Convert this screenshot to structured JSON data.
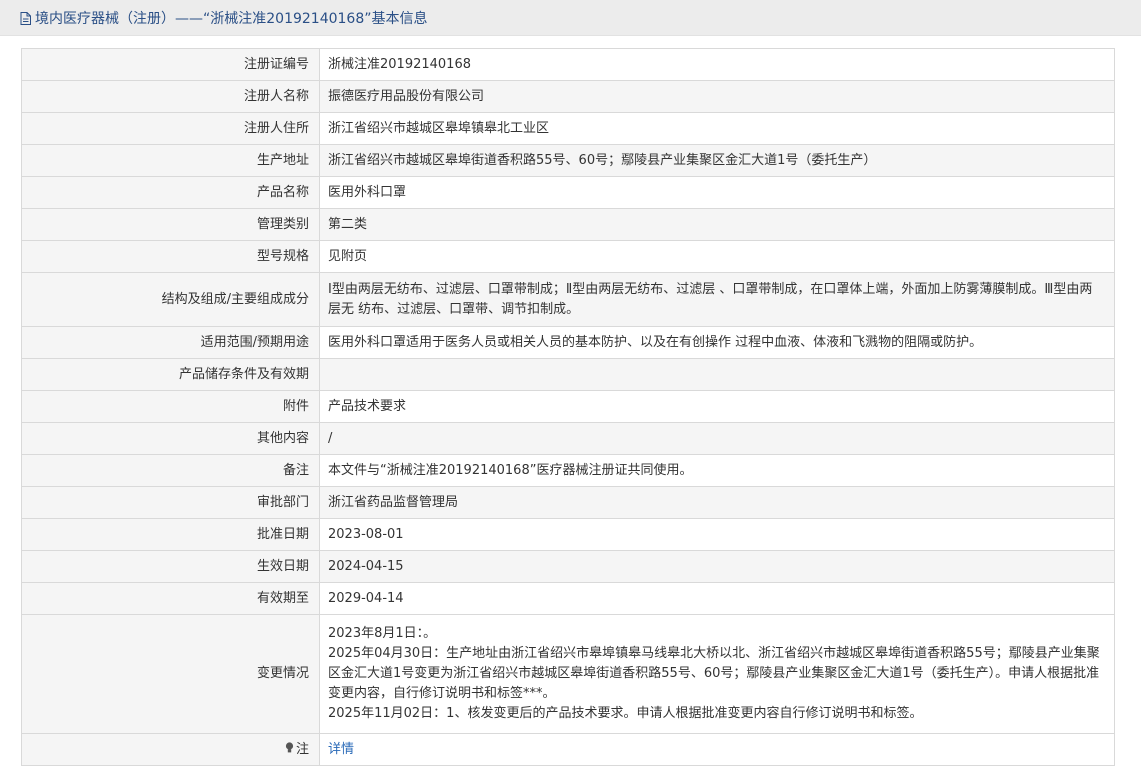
{
  "page_title": "境内医疗器械（注册）——“浙械注准20192140168”基本信息",
  "rows": [
    {
      "label": "注册证编号",
      "value": "浙械注准20192140168"
    },
    {
      "label": "注册人名称",
      "value": "振德医疗用品股份有限公司"
    },
    {
      "label": "注册人住所",
      "value": "浙江省绍兴市越城区皋埠镇皋北工业区"
    },
    {
      "label": "生产地址",
      "value": "浙江省绍兴市越城区皋埠街道香积路55号、60号；鄢陵县产业集聚区金汇大道1号（委托生产）"
    },
    {
      "label": "产品名称",
      "value": "医用外科口罩"
    },
    {
      "label": "管理类别",
      "value": "第二类"
    },
    {
      "label": "型号规格",
      "value": "见附页"
    },
    {
      "label": "结构及组成/主要组成成分",
      "value": "Ⅰ型由两层无纺布、过滤层、口罩带制成；Ⅱ型由两层无纺布、过滤层 、口罩带制成，在口罩体上端，外面加上防雾薄膜制成。Ⅲ型由两层无 纺布、过滤层、口罩带、调节扣制成。"
    },
    {
      "label": "适用范围/预期用途",
      "value": "医用外科口罩适用于医务人员或相关人员的基本防护、以及在有创操作 过程中血液、体液和飞溅物的阻隔或防护。"
    },
    {
      "label": "产品储存条件及有效期",
      "value": ""
    },
    {
      "label": "附件",
      "value": "产品技术要求"
    },
    {
      "label": "其他内容",
      "value": "/"
    },
    {
      "label": "备注",
      "value": "本文件与“浙械注准20192140168”医疗器械注册证共同使用。"
    },
    {
      "label": "审批部门",
      "value": "浙江省药品监督管理局"
    },
    {
      "label": "批准日期",
      "value": "2023-08-01"
    },
    {
      "label": "生效日期",
      "value": "2024-04-15"
    },
    {
      "label": "有效期至",
      "value": "2029-04-14"
    }
  ],
  "changes": {
    "label": "变更情况",
    "lines": [
      "2023年8月1日：。",
      "2025年04月30日：生产地址由浙江省绍兴市皋埠镇皋马线皋北大桥以北、浙江省绍兴市越城区皋埠街道香积路55号；鄢陵县产业集聚区金汇大道1号变更为浙江省绍兴市越城区皋埠街道香积路55号、60号；鄢陵县产业集聚区金汇大道1号（委托生产）。申请人根据批准变更内容，自行修订说明书和标签***。",
      "2025年11月02日：1、核发变更后的产品技术要求。申请人根据批准变更内容自行修订说明书和标签。"
    ]
  },
  "note": {
    "label": "注",
    "link_text": "详情",
    "icon": "bulb-icon"
  },
  "colors": {
    "title": "#2a4f86",
    "link": "#2a6ab8",
    "label_bg": "#f5f5f5",
    "border": "#d9d9d9"
  }
}
